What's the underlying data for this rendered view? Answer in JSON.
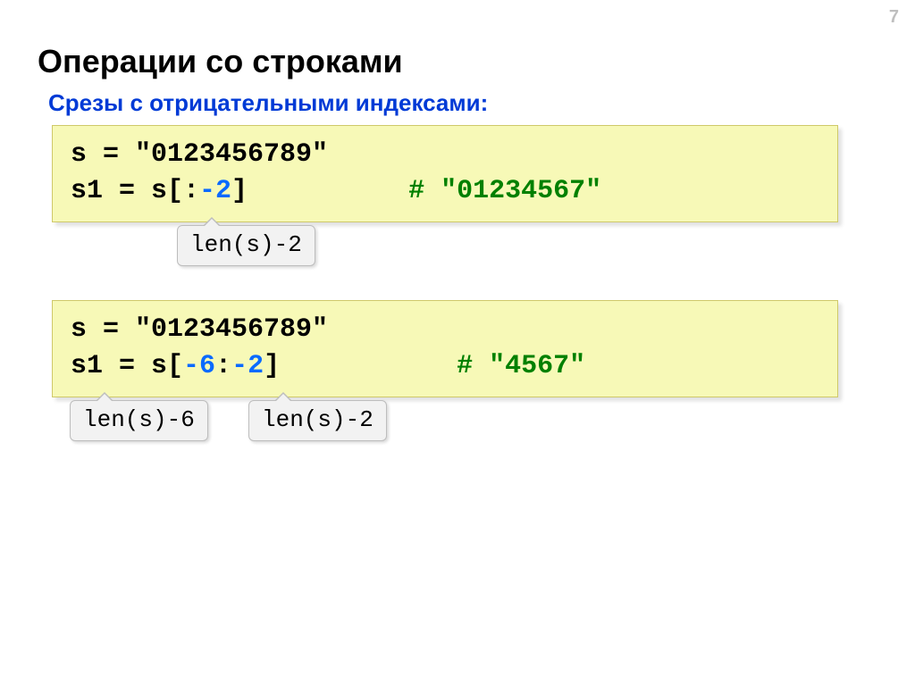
{
  "page_number": "7",
  "title": "Операции со строками",
  "subtitle": "Срезы с отрицательными индексами:",
  "code1": {
    "line1_pre": "s = ",
    "line1_str": "\"0123456789\"",
    "line2_pre": "s1 = s[:",
    "line2_neg": "-2",
    "line2_post": "]",
    "line2_gap": "          ",
    "line2_comment": "# \"01234567\""
  },
  "callout1": "len(s)-2",
  "code2": {
    "line1_pre": "s = ",
    "line1_str": "\"0123456789\"",
    "line2_pre": "s1 = s[",
    "line2_neg1": "-6",
    "line2_mid": ":",
    "line2_neg2": "-2",
    "line2_post": "]",
    "line2_gap": "           ",
    "line2_comment": "# \"4567\""
  },
  "callout2": "len(s)-6",
  "callout3": "len(s)-2"
}
